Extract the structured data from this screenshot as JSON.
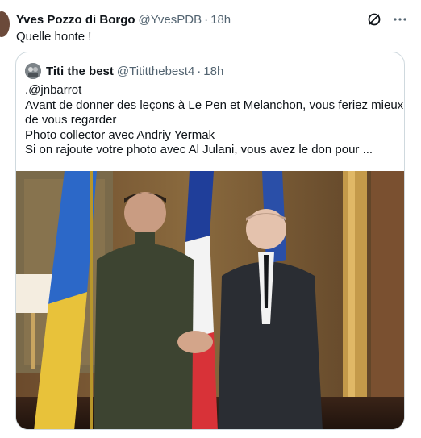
{
  "tweet": {
    "author_name": "Yves Pozzo di Borgo",
    "author_handle": "@YvesPDB",
    "separator": "·",
    "time": "18h",
    "text": "Quelle honte !",
    "icons": [
      "grok-icon",
      "more-icon"
    ]
  },
  "quote": {
    "author_name": "Titi the best",
    "author_handle": "@Tititthebest4",
    "separator": "·",
    "time": "18h",
    "lines": [
      ".@jnbarrot",
      "Avant de donner des leçons à Le Pen et Melanchon, vous feriez mieux",
      "de vous regarder",
      "Photo collector avec Andriy Yermak",
      "Si on rajoute votre photo avec Al Julani, vous avez le don pour ..."
    ]
  },
  "colors": {
    "text": "#0f1419",
    "secondary": "#536471",
    "border": "#cfd9de"
  }
}
